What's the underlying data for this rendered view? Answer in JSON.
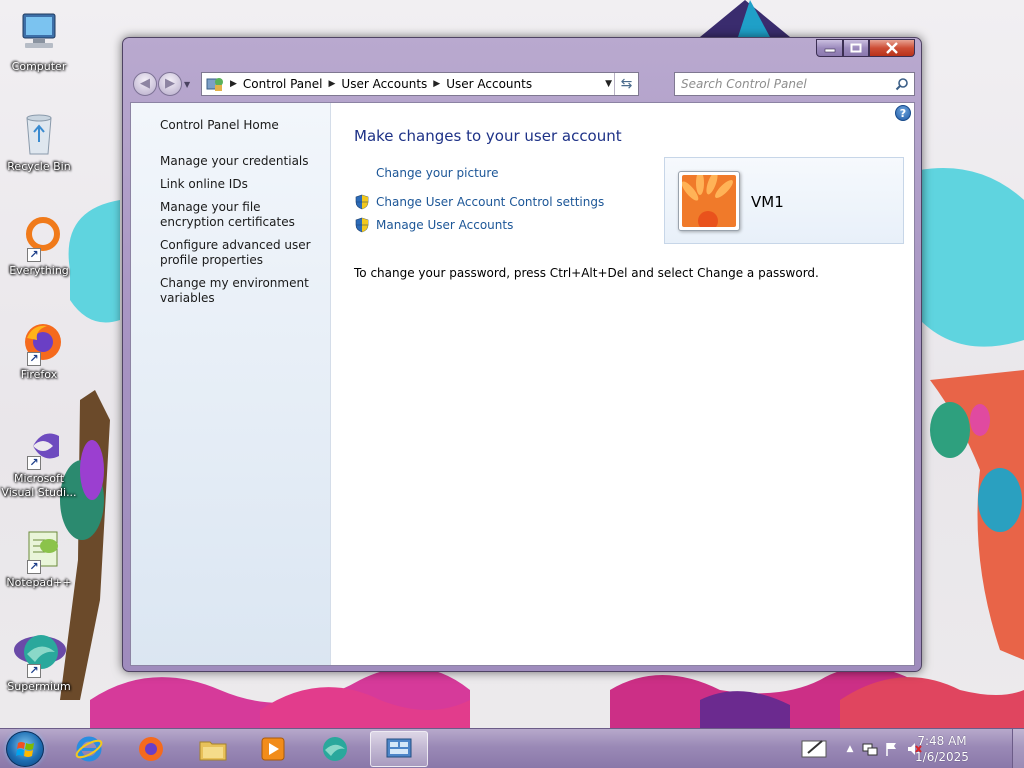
{
  "desktop": {
    "icons": [
      {
        "label": "Computer",
        "icon": "computer-icon"
      },
      {
        "label": "Recycle Bin",
        "icon": "recycle-bin-icon"
      },
      {
        "label": "Everything",
        "icon": "everything-icon"
      },
      {
        "label": "Firefox",
        "icon": "firefox-icon"
      },
      {
        "label": "Microsoft Visual Studi...",
        "icon": "visual-studio-icon"
      },
      {
        "label": "Notepad++",
        "icon": "notepad-plus-plus-icon"
      },
      {
        "label": "Supermium",
        "icon": "supermium-icon"
      }
    ]
  },
  "window": {
    "navbar": {
      "breadcrumb": [
        "Control Panel",
        "User Accounts",
        "User Accounts"
      ],
      "search_placeholder": "Search Control Panel"
    },
    "left_pane": {
      "home": "Control Panel Home",
      "links": [
        "Manage your credentials",
        "Link online IDs",
        "Manage your file encryption certificates",
        "Configure advanced user profile properties",
        "Change my environment variables"
      ]
    },
    "main": {
      "title": "Make changes to your user account",
      "tasks": [
        {
          "label": "Change your picture",
          "shield": false
        },
        {
          "label": "Change User Account Control settings",
          "shield": true
        },
        {
          "label": "Manage User Accounts",
          "shield": true
        }
      ],
      "password_note": "To change your password, press Ctrl+Alt+Del and select Change a password.",
      "user": {
        "name": "VM1"
      }
    }
  },
  "taskbar": {
    "apps": [
      "Internet Explorer",
      "Firefox",
      "File Explorer",
      "Windows Media Player",
      "Supermium",
      "Control Panel"
    ],
    "active_app": "Control Panel",
    "clock": {
      "time": "7:48 AM",
      "date": "1/6/2025"
    }
  },
  "colors": {
    "link": "#1c5697",
    "title": "#1e3287",
    "frame": "#a693c2",
    "taskbar": "#9a89b6"
  }
}
